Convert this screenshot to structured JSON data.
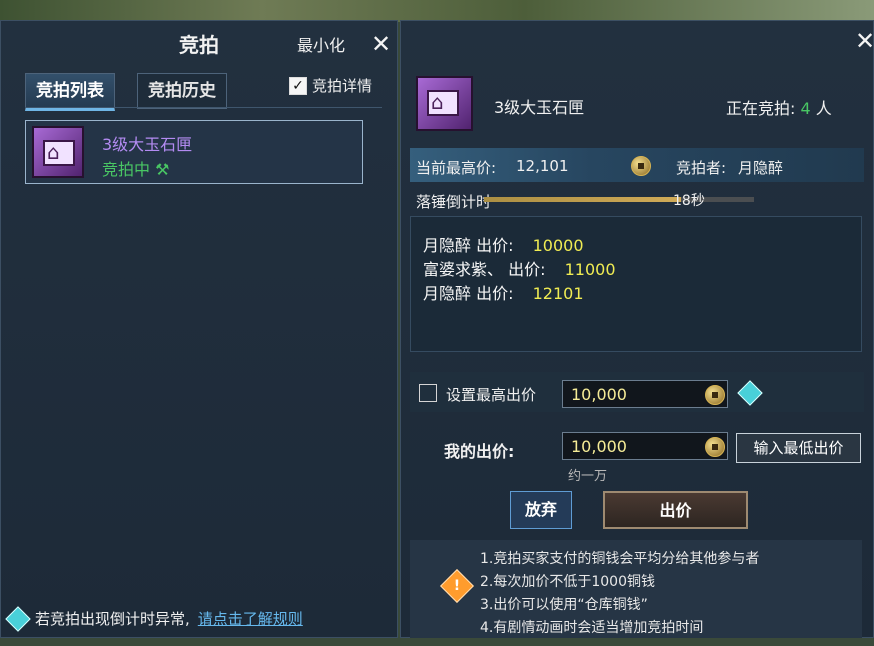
{
  "left_panel": {
    "title": "竞拍",
    "minimize_label": "最小化",
    "tabs": [
      "竞拍列表",
      "竞拍历史"
    ],
    "details_label": "竞拍详情",
    "details_checked": true,
    "item": {
      "name": "3级大玉石匣",
      "status": "竞拍中",
      "status_icon": "gavel-icon"
    },
    "tip_text": "若竞拍出现倒计时异常,",
    "tip_link": "请点击了解规则"
  },
  "right_panel": {
    "item_name": "3级大玉石匣",
    "bidding_label": "正在竞拍:",
    "bidding_count": "4",
    "bidding_unit": "人",
    "current_price_label": "当前最高价:",
    "current_price": "12,101",
    "bidder_label": "竞拍者:",
    "bidder_name": "月隐醉",
    "countdown_label": "落锤倒计时",
    "countdown_value": "18秒",
    "countdown_progress": 0.73,
    "bid_history": [
      {
        "name": "月隐醉",
        "action": "出价:",
        "amount": "10000"
      },
      {
        "name": "富婆求紫、",
        "action": "出价:",
        "amount": "11000"
      },
      {
        "name": "月隐醉",
        "action": "出价:",
        "amount": "12101"
      }
    ],
    "max_bid_label": "设置最高出价",
    "max_bid_value": "10,000",
    "my_bid_label": "我的出价:",
    "my_bid_value": "10,000",
    "my_bid_hint": "约一万",
    "min_bid_button": "输入最低出价",
    "give_up_button": "放弃",
    "bid_button": "出价",
    "rules": [
      "1.竞拍买家支付的铜钱会平均分给其他参与者",
      "2.每次加价不低于1000铜钱",
      "3.出价可以使用“仓库铜钱”",
      "4.有剧情动画时会适当增加竞拍时间"
    ]
  },
  "colors": {
    "accent_blue": "#66b9ee",
    "item_purple": "#b38bf2",
    "status_green": "#49c764",
    "bid_yellow": "#f0ec53"
  }
}
